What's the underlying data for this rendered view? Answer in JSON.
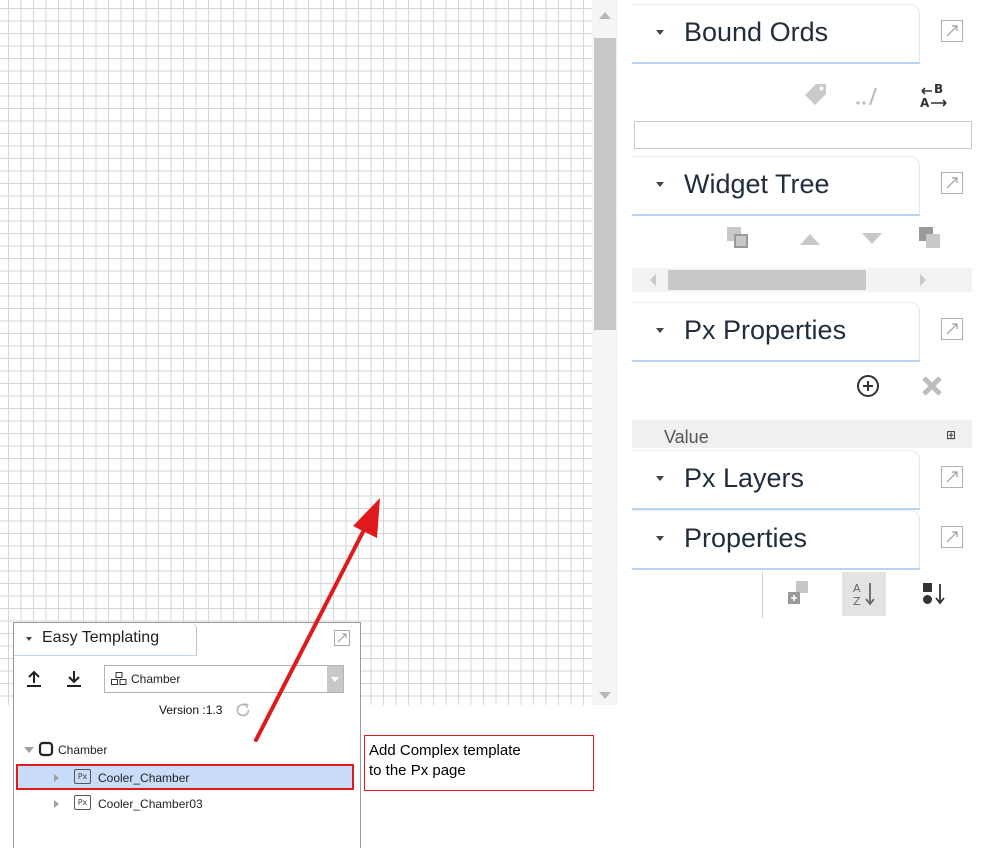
{
  "palettes": {
    "bound_ords": {
      "title": "Bound Ords"
    },
    "widget_tree": {
      "title": "Widget Tree"
    },
    "px_properties": {
      "title": "Px Properties",
      "column_header": "Value"
    },
    "px_layers": {
      "title": "Px Layers"
    },
    "properties": {
      "title": "Properties"
    }
  },
  "easy_templating": {
    "title": "Easy Templating",
    "selected_template": "Chamber",
    "version_label": "Version :1.3",
    "tree": {
      "root": "Chamber",
      "children": [
        "Cooler_Chamber",
        "Cooler_Chamber03"
      ],
      "icon_text": "Px"
    }
  },
  "annotation": {
    "text": "Add Complex template\nto the Px page"
  },
  "colors": {
    "highlight_border": "#e0191d",
    "selection_fill": "#c9dcfa",
    "tab_underline": "#b9d4f2"
  }
}
